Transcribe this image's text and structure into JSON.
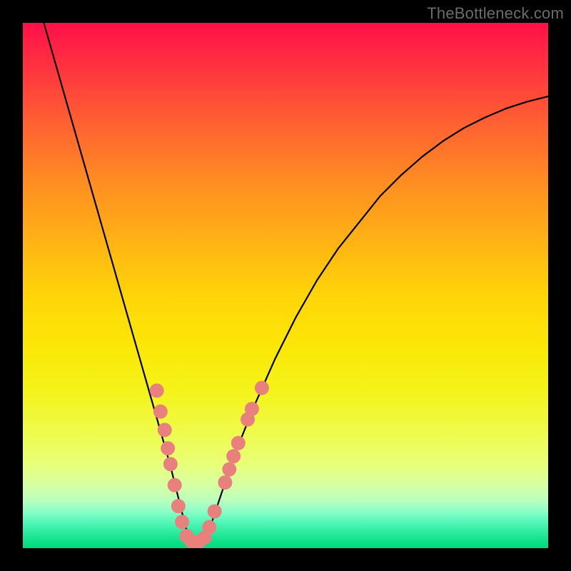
{
  "watermark": "TheBottleneck.com",
  "chart_data": {
    "type": "line",
    "title": "",
    "xlabel": "",
    "ylabel": "",
    "xlim": [
      0,
      100
    ],
    "ylim": [
      0,
      100
    ],
    "gradient_stops": [
      {
        "pos": 0,
        "color": "#ff1049"
      },
      {
        "pos": 18,
        "color": "#ff5c33"
      },
      {
        "pos": 42,
        "color": "#ffb414"
      },
      {
        "pos": 62,
        "color": "#fbe807"
      },
      {
        "pos": 84,
        "color": "#e8ff79"
      },
      {
        "pos": 95,
        "color": "#54f7b9"
      },
      {
        "pos": 100,
        "color": "#00db7c"
      }
    ],
    "series": [
      {
        "name": "bottleneck-curve",
        "x": [
          4,
          6,
          8,
          10,
          12,
          14,
          16,
          18,
          20,
          22,
          24,
          26,
          28,
          30,
          31,
          32,
          33,
          34,
          36,
          38,
          40,
          44,
          48,
          52,
          56,
          60,
          64,
          68,
          72,
          76,
          80,
          84,
          88,
          92,
          96,
          100
        ],
        "y": [
          100,
          93,
          86,
          79,
          72,
          65,
          58,
          51,
          44,
          37,
          30,
          23,
          16,
          8,
          4,
          1,
          0,
          1,
          5,
          11,
          17,
          27,
          36,
          44,
          51,
          57,
          62,
          67,
          71,
          74.5,
          77.5,
          80,
          82,
          83.7,
          85,
          86
        ]
      }
    ],
    "markers": [
      {
        "x": 25.5,
        "y": 30.0
      },
      {
        "x": 26.2,
        "y": 26.0
      },
      {
        "x": 27.0,
        "y": 22.5
      },
      {
        "x": 27.6,
        "y": 19.0
      },
      {
        "x": 28.1,
        "y": 16.0
      },
      {
        "x": 28.9,
        "y": 12.0
      },
      {
        "x": 29.6,
        "y": 8.0
      },
      {
        "x": 30.3,
        "y": 5.0
      },
      {
        "x": 31.2,
        "y": 2.3
      },
      {
        "x": 32.2,
        "y": 1.2
      },
      {
        "x": 33.5,
        "y": 1.2
      },
      {
        "x": 34.6,
        "y": 2.0
      },
      {
        "x": 35.5,
        "y": 4.0
      },
      {
        "x": 36.5,
        "y": 7.0
      },
      {
        "x": 38.5,
        "y": 12.5
      },
      {
        "x": 39.3,
        "y": 15.0
      },
      {
        "x": 40.1,
        "y": 17.5
      },
      {
        "x": 41.0,
        "y": 20.0
      },
      {
        "x": 42.8,
        "y": 24.5
      },
      {
        "x": 43.6,
        "y": 26.5
      },
      {
        "x": 45.5,
        "y": 30.5
      }
    ],
    "marker_style": {
      "color": "#e8817e",
      "radius_px": 10
    }
  }
}
